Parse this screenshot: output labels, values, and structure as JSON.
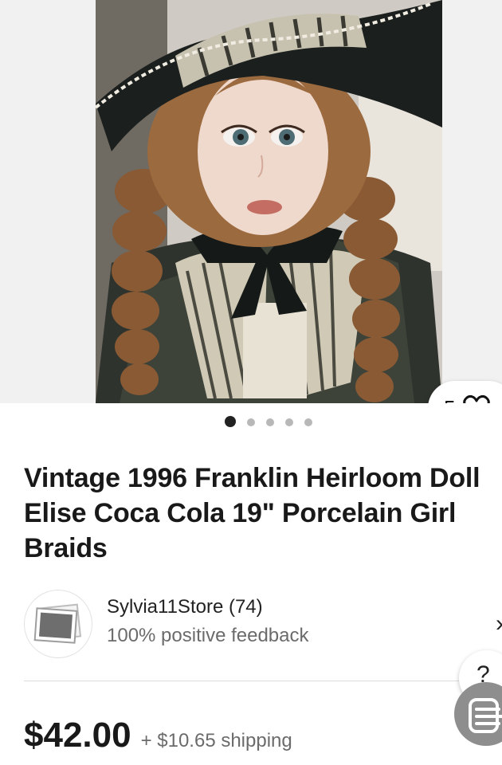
{
  "listing": {
    "image_count": 5,
    "active_image": 1,
    "watch_count": "5",
    "title": "Vintage 1996 Franklin Heirloom Doll Elise Coca Cola 19\" Porcelain Girl Braids"
  },
  "seller": {
    "name": "Sylvia11Store (74)",
    "feedback": "100% positive feedback"
  },
  "pricing": {
    "price": "$42.00",
    "shipping": "+ $10.65 shipping"
  },
  "icons": {
    "watch": "heart-icon",
    "seller_nav": "chevron-right-icon",
    "help": "question-icon",
    "fab": "filter-menu-icon"
  },
  "colors": {
    "text": "#191919",
    "secondary_text": "#6b6b6b",
    "dot_active": "#222222",
    "dot_inactive": "#b8b8b8"
  }
}
